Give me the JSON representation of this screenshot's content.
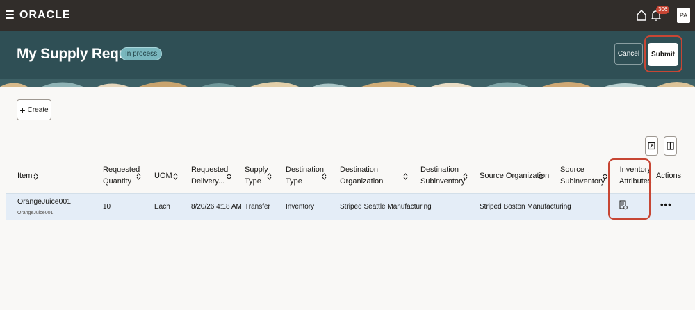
{
  "topbar": {
    "logo": "ORACLE",
    "notification_count": "306",
    "avatar_initials": "PA"
  },
  "header": {
    "title": "My Supply Requests",
    "status": "In process",
    "cancel_label": "Cancel",
    "submit_label": "Submit"
  },
  "toolbar": {
    "create_label": "Create"
  },
  "table": {
    "headers": {
      "item": "Item",
      "requested_quantity_1": "Requested",
      "requested_quantity_2": "Quantity",
      "uom": "UOM",
      "requested_delivery_1": "Requested",
      "requested_delivery_2": "Delivery...",
      "supply_type_1": "Supply",
      "supply_type_2": "Type",
      "destination_type_1": "Destination",
      "destination_type_2": "Type",
      "destination_org_1": "Destination",
      "destination_org_2": "Organization",
      "destination_subinv_1": "Destination",
      "destination_subinv_2": "Subinventory",
      "source_org": "Source Organization",
      "source_subinv_1": "Source",
      "source_subinv_2": "Subinventory",
      "inventory_attributes_1": "Inventory",
      "inventory_attributes_2": "Attributes",
      "actions": "Actions"
    },
    "rows": [
      {
        "item": "OrangeJuice001",
        "item_description": "OrangeJuice001",
        "requested_quantity": "10",
        "uom": "Each",
        "requested_delivery": "8/20/26 4:18 AM",
        "supply_type": "Transfer",
        "destination_type": "Inventory",
        "destination_org": "Striped Seattle Manufacturing",
        "destination_subinv": "",
        "source_org": "Striped Boston Manufacturing",
        "source_subinv": "",
        "actions": "•••"
      }
    ]
  },
  "colors": {
    "topbar": "#312d2a",
    "header": "#2f4f55",
    "highlight_ring": "#c74634",
    "row_selected": "#e4edf7"
  }
}
